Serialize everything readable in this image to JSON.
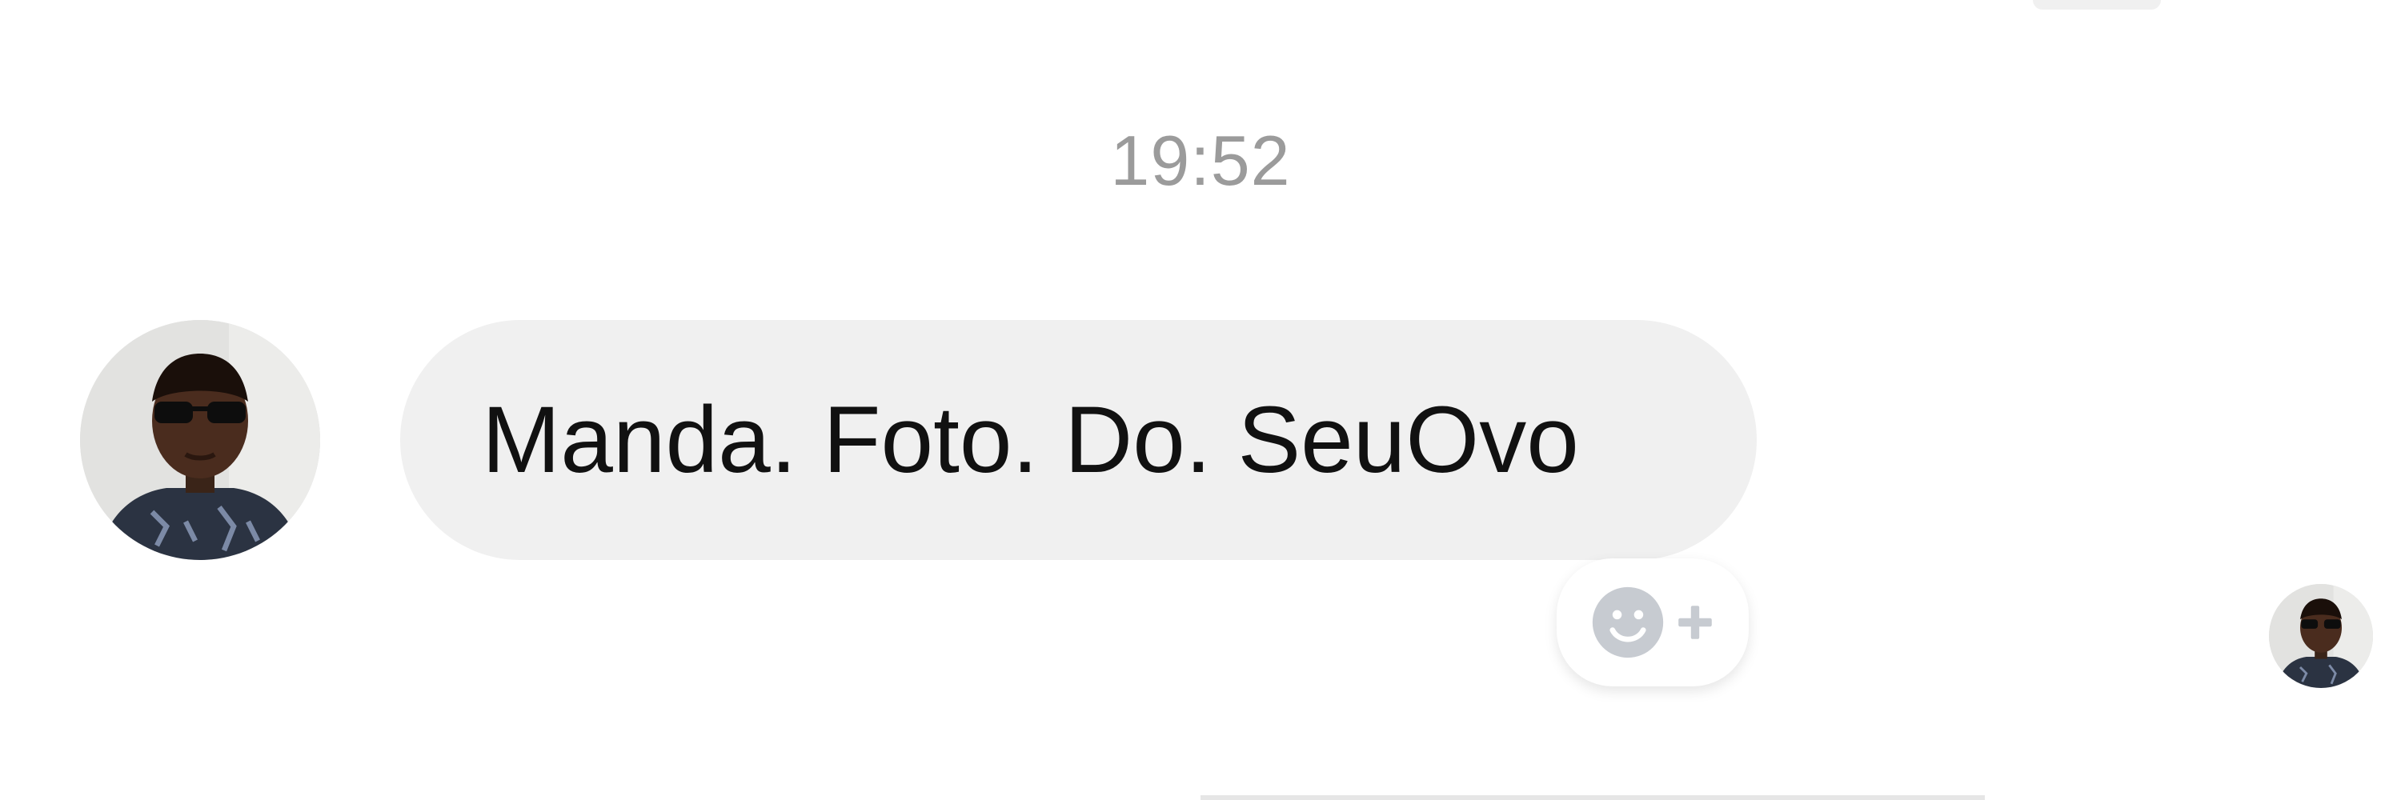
{
  "conversation": {
    "timestamp": "19:52",
    "messages": [
      {
        "text": "Manda. Foto. Do. SeuOvo",
        "direction": "incoming",
        "sender_avatar_icon": "user-photo-avatar-icon"
      }
    ],
    "reaction_button_icon": "add-reaction-icon",
    "seen_indicator_icon": "user-photo-avatar-icon"
  },
  "colors": {
    "background": "#ffffff",
    "bubble": "#f0f0f0",
    "timestamp": "#9b9b9b",
    "message_text": "#111111",
    "reaction_icon": "#c7cbd1"
  }
}
